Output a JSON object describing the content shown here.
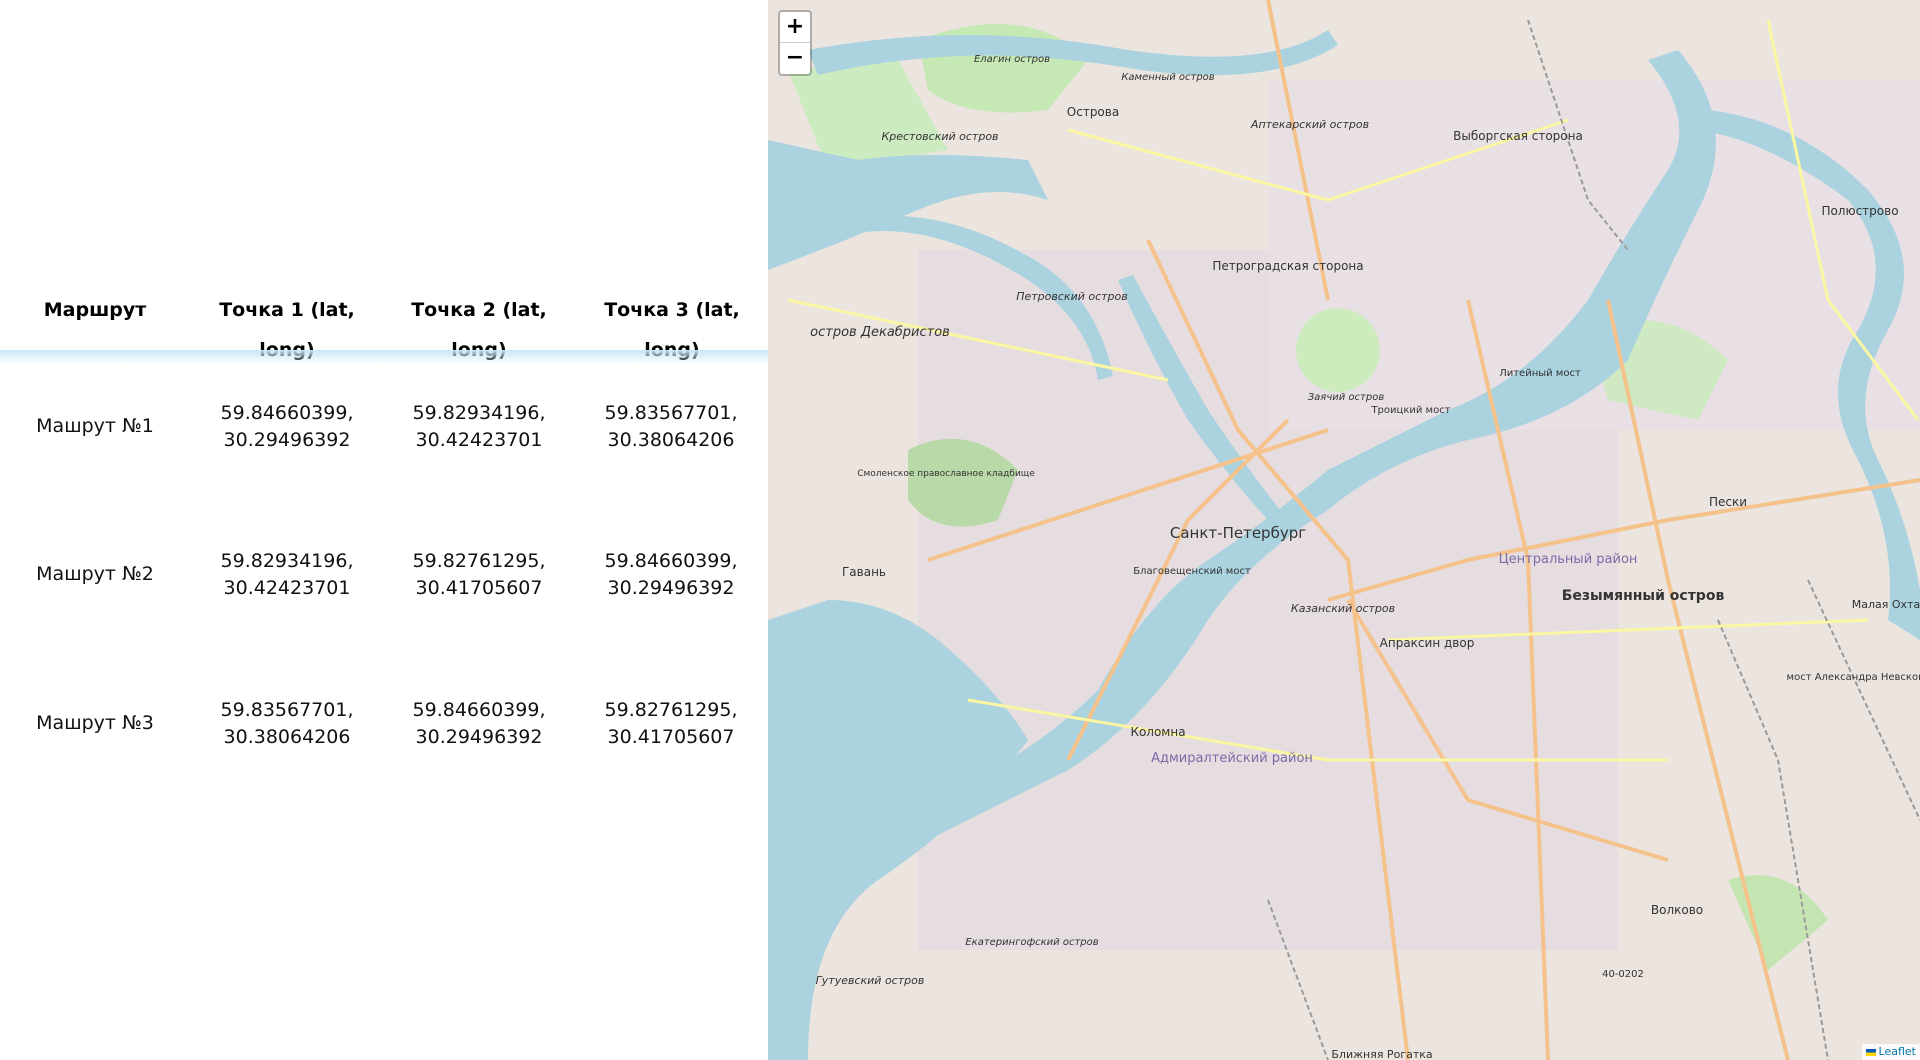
{
  "table": {
    "headers": [
      "Маршрут",
      "Точка 1 (lat, long)",
      "Точка 2 (lat, long)",
      "Точка 3 (lat, long)"
    ],
    "rows": [
      {
        "name": "Машрут №1",
        "p1": [
          "59.84660399,",
          "30.29496392"
        ],
        "p2": [
          "59.82934196,",
          "30.42423701"
        ],
        "p3": [
          "59.83567701,",
          "30.38064206"
        ]
      },
      {
        "name": "Машрут №2",
        "p1": [
          "59.82934196,",
          "30.42423701"
        ],
        "p2": [
          "59.82761295,",
          "30.41705607"
        ],
        "p3": [
          "59.84660399,",
          "30.29496392"
        ]
      },
      {
        "name": "Машрут №3",
        "p1": [
          "59.83567701,",
          "30.38064206"
        ],
        "p2": [
          "59.84660399,",
          "30.29496392"
        ],
        "p3": [
          "59.82761295,",
          "30.41705607"
        ]
      }
    ]
  },
  "map": {
    "zoom_in": "+",
    "zoom_out": "−",
    "attribution": "Leaflet",
    "labels": {
      "island_1": "остров Декабристов",
      "island_2": "Крестовский остров",
      "city": "Санкт-Петербург",
      "district_1": "Петроградская сторона",
      "district_2": "Центральный район",
      "district_3": "Адмиралтейский район",
      "district_4": "Выборгская сторона",
      "district_5": "Безымянный остров",
      "place_1": "Гавань",
      "place_2": "Коломна",
      "place_3": "Пески",
      "place_4": "Волково",
      "place_5": "Острова",
      "place_6": "Полюстрово",
      "road_1": "40-0202",
      "place_7": "Ближняя Рогатка",
      "place_8": "Малая Охта",
      "island_3": "Заячий остров",
      "island_4": "Казанский остров",
      "place_9": "Апраксин двор",
      "bridge_1": "Литейный мост",
      "bridge_2": "Троицкий мост",
      "bridge_3": "Благовещенский мост",
      "island_5": "Гутуевский остров",
      "island_6": "Екатерингофский остров",
      "island_7": "Петровский остров",
      "island_8": "Елагин остров",
      "island_9": "Каменный остров",
      "island_10": "Аптекарский остров",
      "place_10": "Смоленское православное кладбище",
      "bridge_4": "мост Александра Невского"
    }
  }
}
